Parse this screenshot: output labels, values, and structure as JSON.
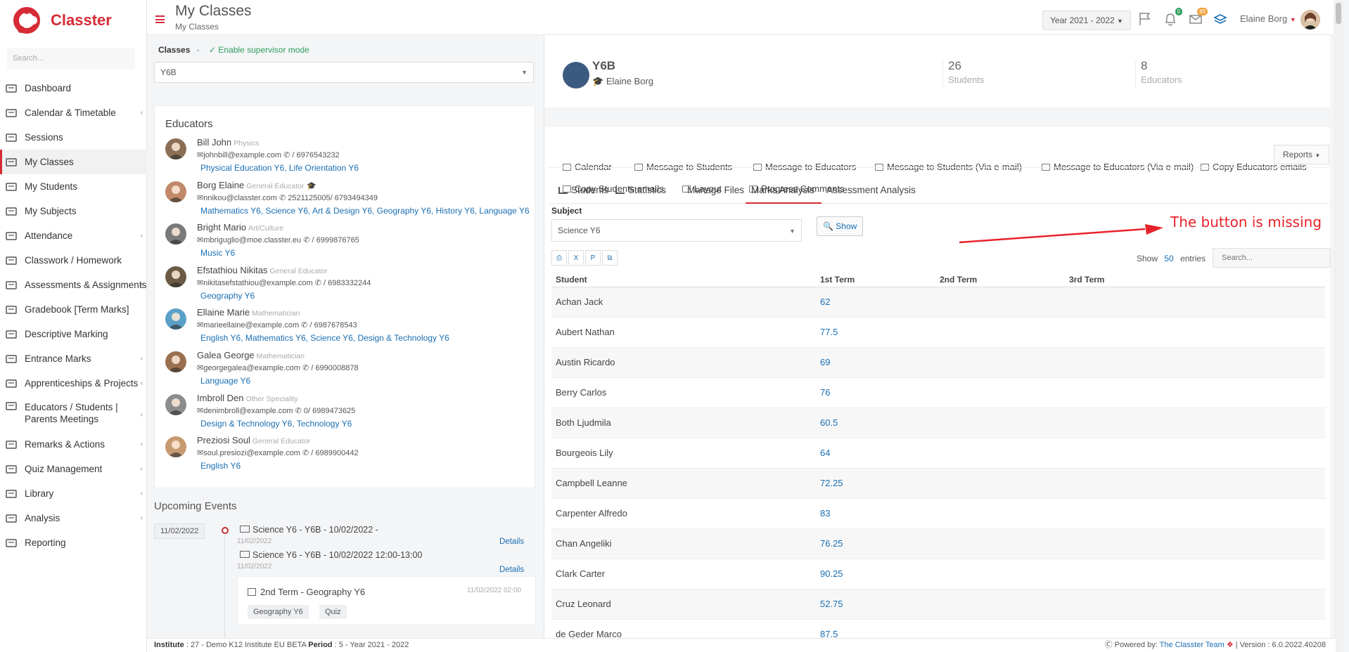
{
  "app": {
    "brand": "Classter",
    "search_placeholder": "Search..."
  },
  "sidebar": {
    "items": [
      {
        "label": "Dashboard",
        "icon": "monitor-icon",
        "chevron": false
      },
      {
        "label": "Calendar & Timetable",
        "icon": "calendar-icon",
        "chevron": true
      },
      {
        "label": "Sessions",
        "icon": "sessions-icon",
        "chevron": false
      },
      {
        "label": "My Classes",
        "icon": "classes-icon",
        "chevron": false,
        "active": true
      },
      {
        "label": "My Students",
        "icon": "students-icon",
        "chevron": false
      },
      {
        "label": "My Subjects",
        "icon": "book-icon",
        "chevron": false
      },
      {
        "label": "Attendance",
        "icon": "attendance-icon",
        "chevron": true
      },
      {
        "label": "Classwork / Homework",
        "icon": "list-icon",
        "chevron": false
      },
      {
        "label": "Assessments & Assignments",
        "icon": "edit-icon",
        "chevron": true
      },
      {
        "label": "Gradebook [Term Marks]",
        "icon": "gradebook-icon",
        "chevron": false
      },
      {
        "label": "Descriptive Marking",
        "icon": "chart-icon",
        "chevron": false
      },
      {
        "label": "Entrance Marks",
        "icon": "clipboard-icon",
        "chevron": true
      },
      {
        "label": "Apprenticeships & Projects",
        "icon": "cube-icon",
        "chevron": true
      },
      {
        "label": "Educators / Students | Parents Meetings",
        "icon": "meetings-icon",
        "chevron": true
      },
      {
        "label": "Remarks & Actions",
        "icon": "shuffle-icon",
        "chevron": true
      },
      {
        "label": "Quiz Management",
        "icon": "quiz-icon",
        "chevron": true
      },
      {
        "label": "Library",
        "icon": "library-icon",
        "chevron": true
      },
      {
        "label": "Analysis",
        "icon": "analysis-icon",
        "chevron": true
      },
      {
        "label": "Reporting",
        "icon": "printer-icon",
        "chevron": false
      }
    ]
  },
  "header": {
    "title": "My Classes",
    "subtitle": "My Classes",
    "year": "Year 2021 - 2022",
    "notifications_count": "0",
    "messages_count": "89",
    "user_name": "Elaine Borg"
  },
  "left": {
    "classes_label": "Classes",
    "dash": "-",
    "supervisor_link": "Enable supervisor mode",
    "selected_class": "Y6B",
    "educators_title": "Educators",
    "educators": [
      {
        "name": "Bill John",
        "spec": "Physics",
        "email": "johnbill@example.com",
        "phone": "/ 6976543232",
        "subjects": "Physical Education Y6, Life Orientation Y6"
      },
      {
        "name": "Borg Elaine",
        "spec": "General Educator",
        "email": "nnikou@classter.com",
        "phone": "2521125005/ 6793494349",
        "subjects": "Mathematics Y6, Science Y6, Art & Design Y6, Geography Y6, History Y6, Language Y6"
      },
      {
        "name": "Bright Mario",
        "spec": "Art/Culture",
        "email": "mbriguglio@moe.classter.eu",
        "phone": "/ 6999876765",
        "subjects": "Music Y6"
      },
      {
        "name": "Efstathiou Nikitas",
        "spec": "General Educator",
        "email": "nikitasefstathiou@example.com",
        "phone": "/ 6983332244",
        "subjects": "Geography Y6"
      },
      {
        "name": "Ellaine Marie",
        "spec": "Mathematician",
        "email": "marieellaine@example.com",
        "phone": "/ 6987678543",
        "subjects": "English Y6, Mathematics Y6, Science Y6, Design & Technology Y6"
      },
      {
        "name": "Galea George",
        "spec": "Mathematician",
        "email": "georgegalea@example.com",
        "phone": "/ 6990008878",
        "subjects": "Language Y6"
      },
      {
        "name": "Imbroll Den",
        "spec": "Other Speciality",
        "email": "denimbroll@example.com",
        "phone": "0/ 6989473625",
        "subjects": "Design & Technology Y6, Technology Y6"
      },
      {
        "name": "Preziosi Soul",
        "spec": "General Educator",
        "email": "soul.presiozi@example.com",
        "phone": "/ 6989900442",
        "subjects": "English Y6"
      }
    ],
    "events_title": "Upcoming Events",
    "event_date": "11/02/2022",
    "events": [
      {
        "title": "Science Y6 - Y6B - 10/02/2022 -",
        "sub": "11/02/2022",
        "details": "Details"
      },
      {
        "title": "Science Y6 - Y6B - 10/02/2022 12:00-13:00",
        "sub": "11/02/2022",
        "details": "Details"
      }
    ],
    "event_card": {
      "title": "2nd Term - Geography Y6",
      "time": "11/02/2022 02:00",
      "tags": [
        "Geography Y6",
        "Quiz"
      ]
    }
  },
  "right": {
    "class_name": "Y6B",
    "class_teacher": "Elaine Borg",
    "students_count": "26",
    "students_label": "Students",
    "educators_count": "8",
    "educators_label": "Educators",
    "actions": [
      "Calendar",
      "Message to Students",
      "Message to Educators",
      "Message to Students (Via e-mail)",
      "Message to Educators (Via e-mail)",
      "Copy Educators emails",
      "Copy Students emails",
      "Layout",
      "Progress Comments"
    ],
    "reports_label": "Reports",
    "tabs": [
      "Students",
      "Statistics",
      "Manage Files",
      "Marks Analysis",
      "Assessment Analysis"
    ],
    "subject_label": "Subject",
    "subject_value": "Science Y6",
    "show_label": "Show",
    "annotation": "The button is missing",
    "show_entries_prefix": "Show",
    "show_entries_value": "50",
    "show_entries_suffix": "entries",
    "table_search_placeholder": "Search...",
    "table_headers": [
      "Student",
      "1st Term",
      "2nd Term",
      "3rd Term"
    ],
    "rows": [
      {
        "student": "Achan Jack",
        "t1": "62"
      },
      {
        "student": "Aubert Nathan",
        "t1": "77.5"
      },
      {
        "student": "Austin Ricardo",
        "t1": "69"
      },
      {
        "student": "Berry Carlos",
        "t1": "76"
      },
      {
        "student": "Both Ljudmila",
        "t1": "60.5"
      },
      {
        "student": "Bourgeois Lily",
        "t1": "64"
      },
      {
        "student": "Campbell Leanne",
        "t1": "72.25"
      },
      {
        "student": "Carpenter Alfredo",
        "t1": "83"
      },
      {
        "student": "Chan Angeliki",
        "t1": "76.25"
      },
      {
        "student": "Clark Carter",
        "t1": "90.25"
      },
      {
        "student": "Cruz Leonard",
        "t1": "52.75"
      },
      {
        "student": "de Geder Marco",
        "t1": "87.5"
      }
    ]
  },
  "footer": {
    "institute_label": "Institute",
    "institute_value": ": 27 - Demo K12 Institute EU BETA",
    "period_label": "Period",
    "period_value": ": 5 - Year 2021 - 2022",
    "powered_by": "Powered by:",
    "team": "The Classter Team",
    "version": "| Version : 6.0.2022.40208"
  },
  "colors": {
    "brand": "#d62b35",
    "link": "#1a6fb3",
    "annotation": "#e8222a",
    "supervisor": "#2e9f5b"
  }
}
